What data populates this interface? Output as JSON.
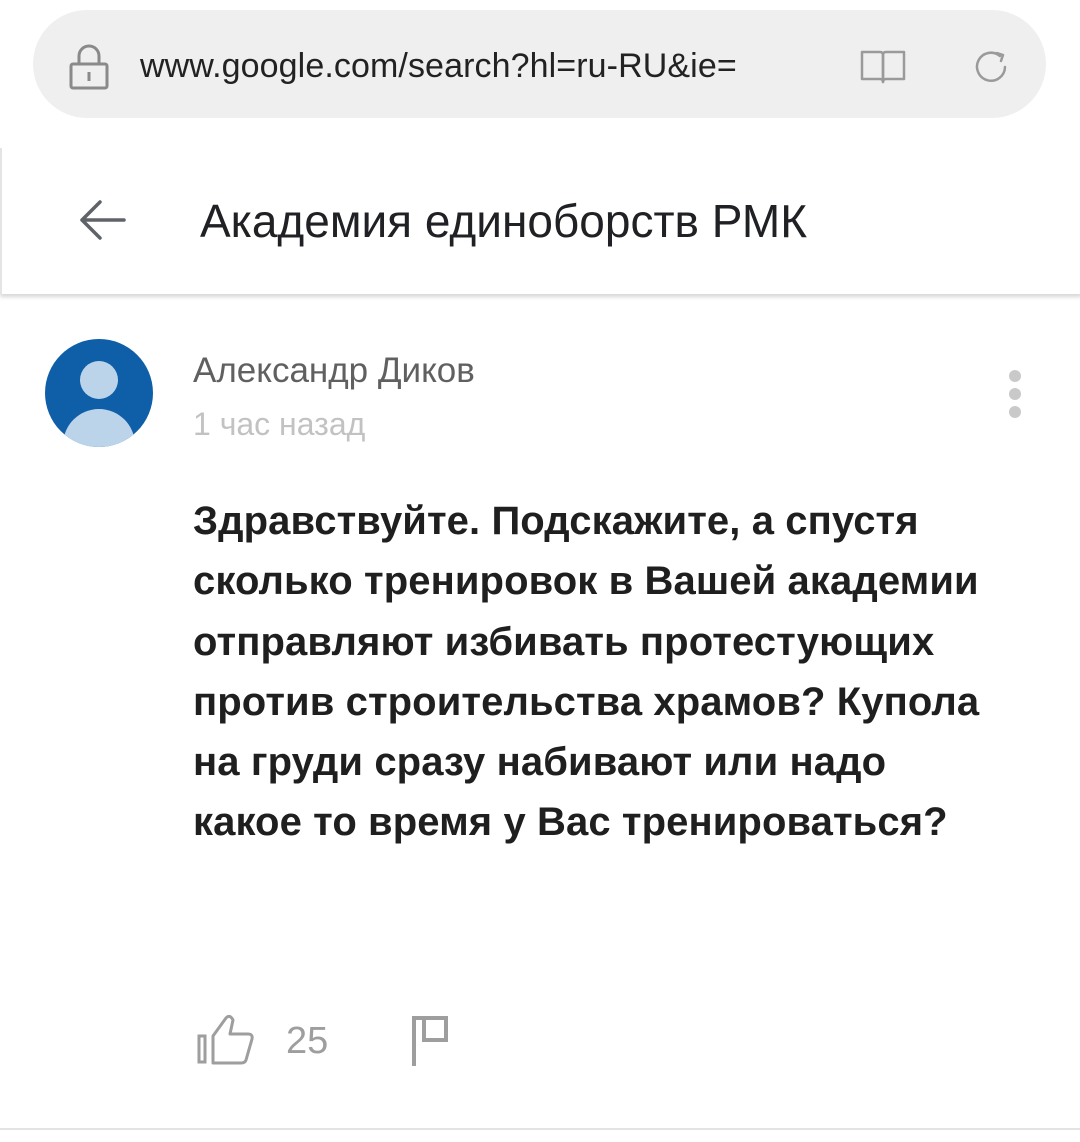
{
  "browser": {
    "url": "www.google.com/search?hl=ru-RU&ie=",
    "icons": {
      "lock": "lock-icon",
      "reader": "reader-mode-icon",
      "reload": "reload-icon"
    }
  },
  "header": {
    "title": "Академия единоборств РМК",
    "back_icon": "arrow-left-icon"
  },
  "comment": {
    "author": "Александр Диков",
    "time": "1 час назад",
    "text": "Здравствуйте. Подскажите, а спустя сколько тренировок в Вашей академии отправляют избивать протестующих против строительства храмов? Купола на груди сразу набивают или надо какое то время у Вас тренироваться?",
    "likes": "25",
    "colors": {
      "avatar_bg": "#0f5fa8",
      "avatar_fg": "#bcd4ea",
      "muted": "#9e9e9e"
    },
    "icons": {
      "more": "more-vert-icon",
      "like": "thumbs-up-icon",
      "flag": "flag-icon"
    }
  }
}
